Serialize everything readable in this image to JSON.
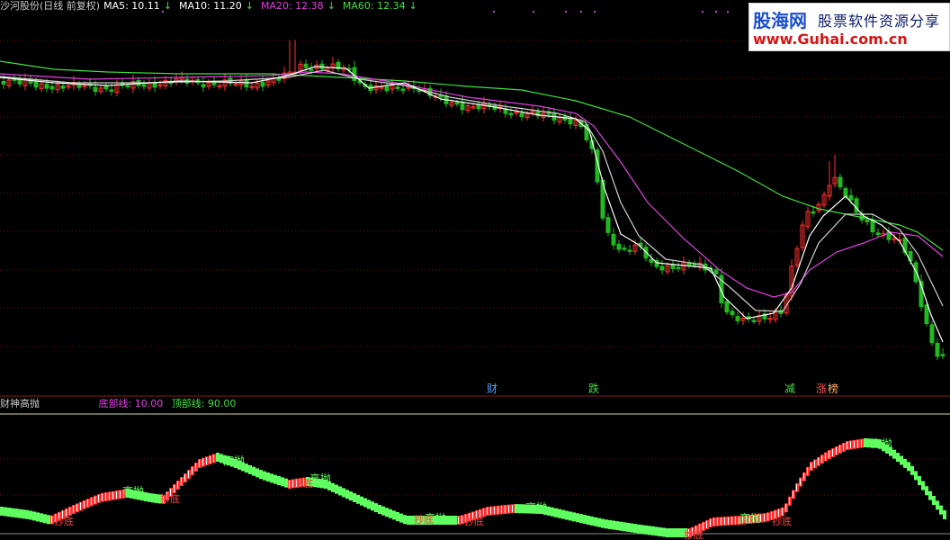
{
  "header": {
    "stock": "沙河股份(日线 前复权)",
    "ma5": "MA5: 10.11",
    "ma10": "MA10: 11.20",
    "ma20": "MA20: 12.38",
    "ma60": "MA60: 12.34",
    "down_arrow": "↓"
  },
  "events": [
    "财",
    "跌",
    "减",
    "涨",
    "榜"
  ],
  "indicator": {
    "name": "财神高抛",
    "bottom_line": "底部线: 10.00",
    "top_line": "顶部线: 90.00",
    "sell_label": "高抛",
    "buy_label": "抄底"
  },
  "watermark": {
    "brand": "股海网",
    "tagline": "股票软件资源分享",
    "url": "www.Guhai.com.cn"
  },
  "colors": {
    "background": "#000000",
    "ma5": "#ffffff",
    "ma10": "#ffffff",
    "ma20": "#e040e0",
    "ma60": "#40e040",
    "up_candle": "#ff3030",
    "down_candle": "#22b822",
    "grid": "#6b1010",
    "signal_text": "#60ff60"
  }
}
